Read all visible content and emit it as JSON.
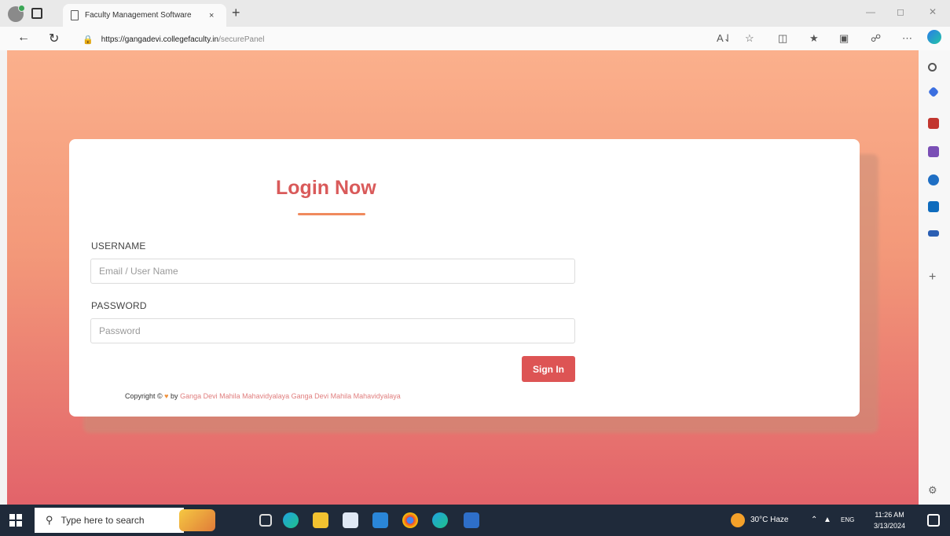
{
  "browser": {
    "tab_title": "Faculty Management Software",
    "tab_close": "×",
    "new_tab": "+",
    "url_host": "https://gangadevi.collegefaculty.in",
    "url_path": "/securePanel",
    "icons": [
      "profile-icon",
      "tabs-icon",
      "back-icon",
      "refresh-icon",
      "lock-icon",
      "read-aloud-icon",
      "favorite-icon",
      "split-screen-icon",
      "favorites-bar-icon",
      "collections-icon",
      "extensions-icon",
      "more-icon",
      "copilot-icon"
    ]
  },
  "login": {
    "title": "Login Now",
    "username_label": "USERNAME",
    "username_placeholder": "Email / User Name",
    "password_label": "PASSWORD",
    "password_placeholder": "Password",
    "submit_label": "Sign In",
    "copyright_prefix": "Copyright ©",
    "copyright_heart": "♥",
    "copyright_by": "by",
    "copyright_credit": "Ganga Devi Mahila Mahavidyalaya Ganga Devi Mahila Mahavidyalaya"
  },
  "colors": {
    "title": "#d95a5a",
    "button": "#dd5454",
    "bg_top": "#fbb08c",
    "bg_bottom": "#e2636a"
  },
  "taskbar": {
    "search_placeholder": "Type here to search",
    "weather": "30°C Haze",
    "lang": "ENG",
    "time": "11:26 AM",
    "date": "3/13/2024"
  }
}
